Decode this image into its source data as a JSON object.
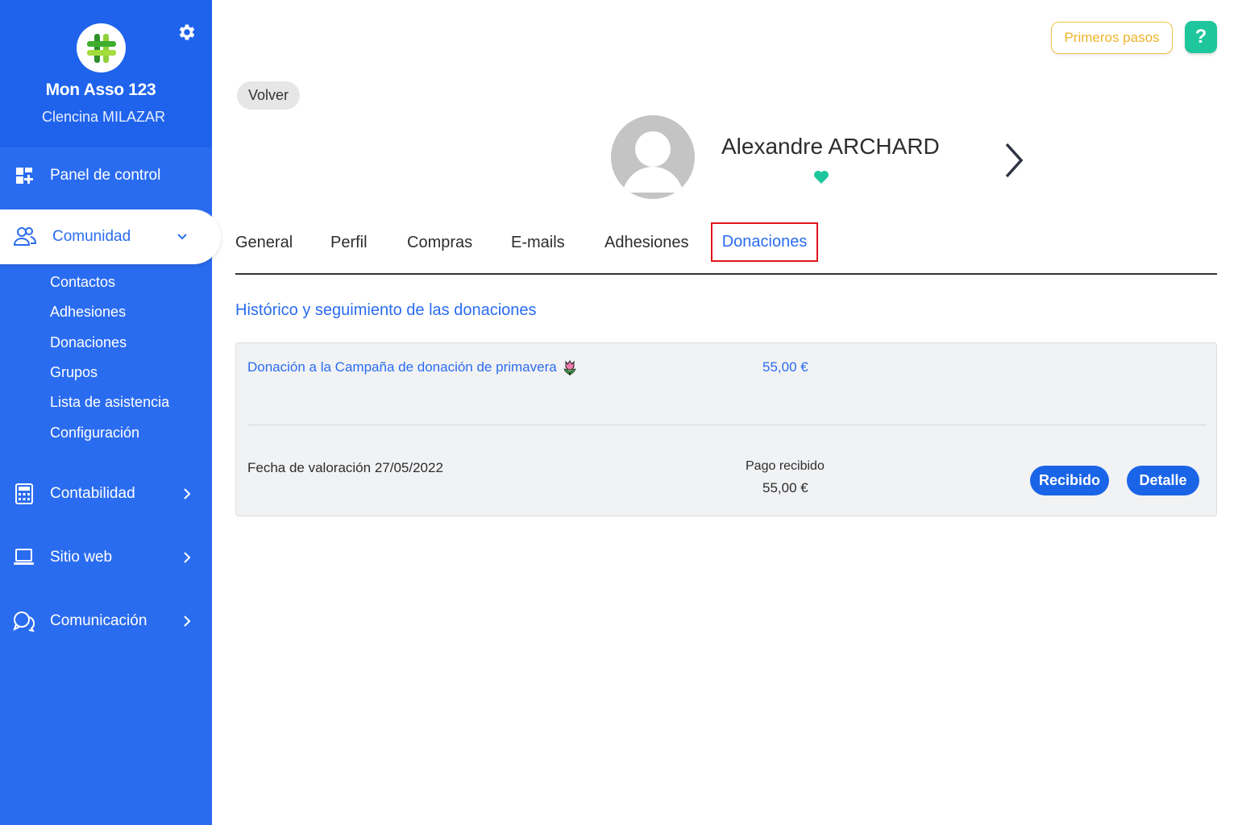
{
  "sidebar": {
    "org_name": "Mon Asso 123",
    "org_user": "Clencina MILAZAR",
    "nav": {
      "panel": "Panel de control",
      "comunidad": "Comunidad",
      "contabilidad": "Contabilidad",
      "sitio_web": "Sitio web",
      "comunicacion": "Comunicación"
    },
    "submenu": [
      "Contactos",
      "Adhesiones",
      "Donaciones",
      "Grupos",
      "Lista de asistencia",
      "Configuración"
    ]
  },
  "header": {
    "primeros_pasos": "Primeros pasos",
    "help": "?"
  },
  "contact": {
    "back_label": "Volver",
    "name": "Alexandre ARCHARD"
  },
  "tabs": [
    "General",
    "Perfil",
    "Compras",
    "E-mails",
    "Adhesiones",
    "Donaciones"
  ],
  "active_tab": "Donaciones",
  "donations": {
    "section_title": "Histórico y seguimiento de las donaciones",
    "item": {
      "title": "Donación a la Campaña de donación de primavera",
      "amount": "55,00 €",
      "fecha": "Fecha de valoración 27/05/2022",
      "pago_status": "Pago recibido",
      "pago_amount": "55,00 €",
      "btn_recibido": "Recibido",
      "btn_detalle": "Detalle"
    }
  },
  "colors": {
    "sidebar_bg": "#2a6cf0",
    "accent": "#2a6cf0",
    "button_blue": "#1a64e8",
    "highlight_red": "#e0141c",
    "help_green": "#1ec79b",
    "heart_teal": "#1ec79b",
    "primeros_gold": "#f0b32a"
  },
  "icons": [
    "settings-gear-icon",
    "dashboard-icon",
    "community-icon",
    "calculator-icon",
    "laptop-icon",
    "chat-icon",
    "chevron-down-icon",
    "chevron-right-icon",
    "heart-icon",
    "tulip-icon",
    "avatar-placeholder-icon"
  ]
}
